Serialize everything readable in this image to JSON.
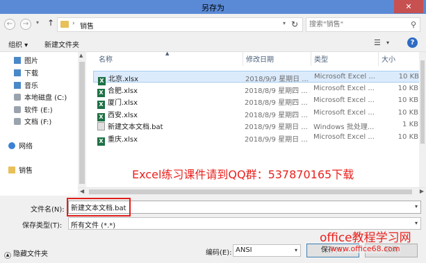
{
  "window": {
    "title": "另存为",
    "close_label": "✕"
  },
  "address": {
    "breadcrumb": "销售",
    "separator": "›",
    "search_placeholder": "搜索\"销售\""
  },
  "toolbar": {
    "organize_label": "组织 ▾",
    "new_folder_label": "新建文件夹"
  },
  "nav": {
    "items": [
      {
        "label": "图片",
        "icon": "pictures-icon"
      },
      {
        "label": "下载",
        "icon": "downloads-icon"
      },
      {
        "label": "音乐",
        "icon": "music-icon"
      },
      {
        "label": "本地磁盘 (C:)",
        "icon": "drive-icon"
      },
      {
        "label": "软件 (E:)",
        "icon": "drive-icon"
      },
      {
        "label": "文档 (F:)",
        "icon": "drive-icon"
      },
      {
        "label": "网络",
        "icon": "network-icon"
      },
      {
        "label": "销售",
        "icon": "folder-icon"
      }
    ]
  },
  "columns": {
    "name": "名称",
    "date": "修改日期",
    "type": "类型",
    "size": "大小"
  },
  "files": [
    {
      "name": "北京.xlsx",
      "date": "2018/9/9 星期日 ...",
      "type": "Microsoft Excel ...",
      "size": "10 KB",
      "kind": "xlsx",
      "selected": true
    },
    {
      "name": "合肥.xlsx",
      "date": "2018/8/9 星期四 ...",
      "type": "Microsoft Excel ...",
      "size": "10 KB",
      "kind": "xlsx",
      "selected": false
    },
    {
      "name": "厦门.xlsx",
      "date": "2018/8/9 星期四 ...",
      "type": "Microsoft Excel ...",
      "size": "10 KB",
      "kind": "xlsx",
      "selected": false
    },
    {
      "name": "西安.xlsx",
      "date": "2018/8/9 星期四 ...",
      "type": "Microsoft Excel ...",
      "size": "10 KB",
      "kind": "xlsx",
      "selected": false
    },
    {
      "name": "新建文本文档.bat",
      "date": "2018/9/9 星期日 ...",
      "type": "Windows 批处理...",
      "size": "1 KB",
      "kind": "bat",
      "selected": false
    },
    {
      "name": "重庆.xlsx",
      "date": "2018/9/9 星期日 ...",
      "type": "Microsoft Excel ...",
      "size": "10 KB",
      "kind": "xlsx",
      "selected": false
    }
  ],
  "overlay_text": "Excel练习课件请到QQ群：537870165下载",
  "form": {
    "filename_label": "文件名(N):",
    "filename_value": "新建文本文档.bat",
    "filetype_label": "保存类型(T):",
    "filetype_value": "所有文件 (*.*)",
    "encoding_label": "编码(E):",
    "encoding_value": "ANSI",
    "hide_folders_label": "隐藏文件夹",
    "save_label": "保存(S)",
    "cancel_label": "取消"
  },
  "watermark": {
    "line1": "office教程学习网",
    "line2": "www.office68.com"
  },
  "colors": {
    "titlebar": "#5a8ad6",
    "close": "#c75050",
    "selection": "#dcebfc",
    "highlight": "#e0201b",
    "excel": "#1e7145"
  }
}
